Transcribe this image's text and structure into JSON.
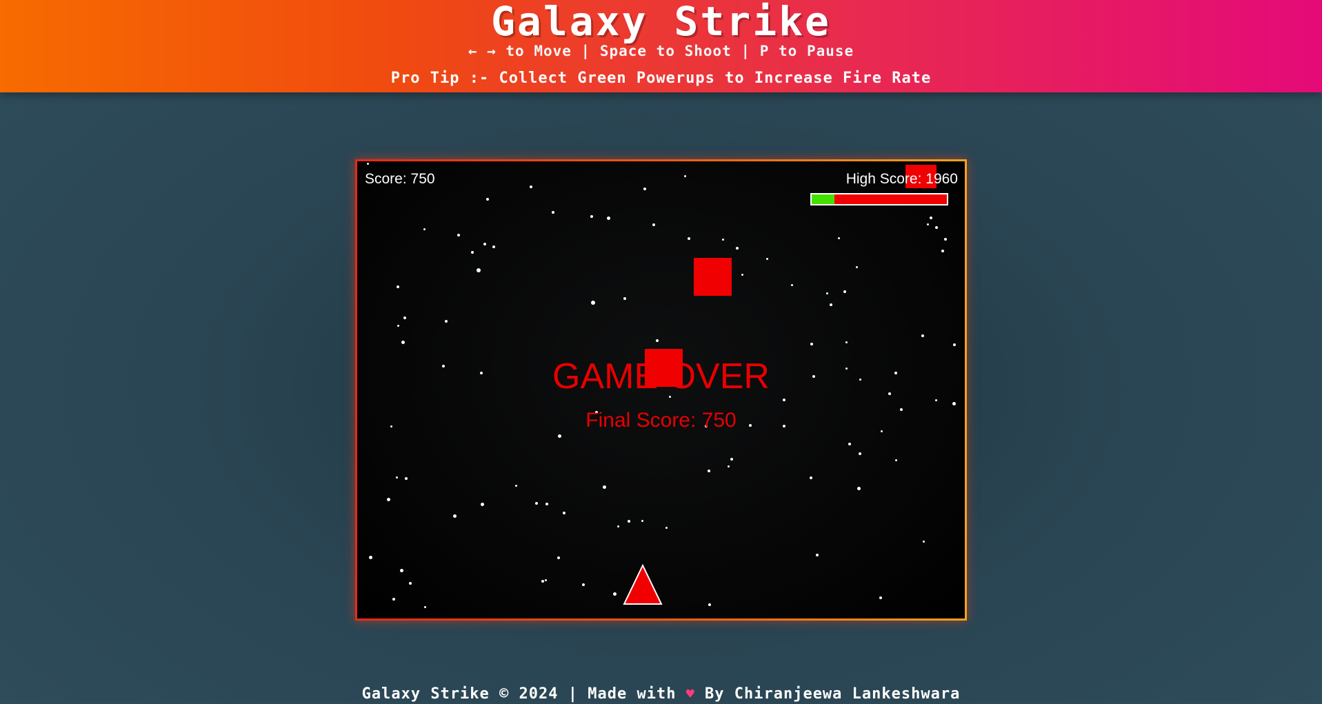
{
  "header": {
    "title": "Galaxy Strike",
    "controls": "← → to Move | Space to Shoot | P to Pause",
    "tip": "Pro Tip :- Collect Green Powerups to Increase Fire Rate"
  },
  "game": {
    "score_label": "Score: 750",
    "high_score_label": "High Score: 1960",
    "game_over": "GAME OVER",
    "final_score": "Final Score: 750",
    "power_level": 0.17,
    "colors": {
      "enemy": "#f00000",
      "power_fill": "#44e000",
      "power_bg": "#f00000",
      "game_over_text": "#e80000"
    }
  },
  "footer": {
    "pre": "Galaxy Strike © 2024 | Made with ",
    "heart_icon": "heart-icon",
    "post": " By Chiranjeewa Lankeshwara"
  }
}
